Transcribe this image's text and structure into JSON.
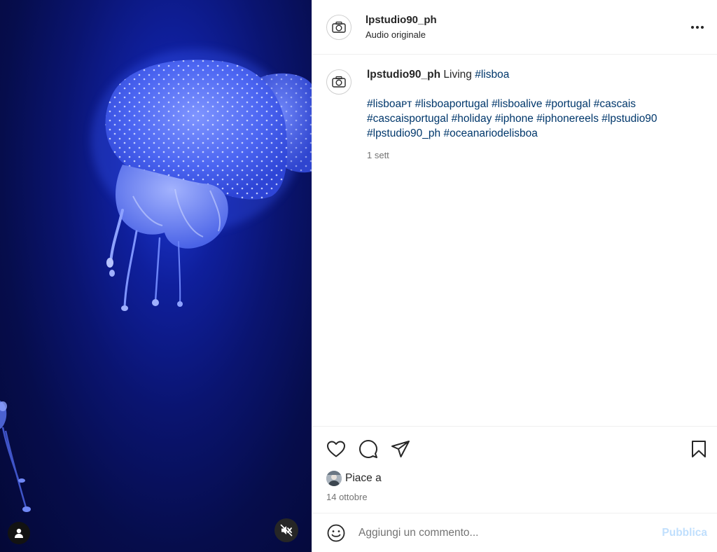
{
  "media": {
    "user_tag_icon": "user-icon",
    "mute_icon": "speaker-muted-icon"
  },
  "header": {
    "username": "lpstudio90_ph",
    "audio": "Audio originale",
    "more_icon": "more-horizontal-icon"
  },
  "caption": {
    "username": "lpstudio90_ph",
    "text": "Living",
    "first_tag": "#lisboa",
    "tags": [
      "#lisboaᴘᴛ",
      "#lisboaportugal",
      "#lisboalive",
      "#portugal",
      "#cascais",
      "#cascaisportugal",
      "#holiday",
      "#iphone",
      "#iphonereels",
      "#lpstudio90",
      "#lpstudio90_ph",
      "#oceanariodelisboa"
    ],
    "age": "1 sett"
  },
  "actions": {
    "like_icon": "heart-icon",
    "comment_icon": "comment-icon",
    "share_icon": "send-icon",
    "save_icon": "bookmark-icon"
  },
  "likes": {
    "label": "Piace a",
    "date": "14 ottobre"
  },
  "comment": {
    "placeholder": "Aggiungi un commento...",
    "post_label": "Pubblica"
  },
  "colors": {
    "link": "#00376b",
    "muted": "#737373",
    "post_disabled": "#c0dffd",
    "media_bg": "#0a1470"
  }
}
